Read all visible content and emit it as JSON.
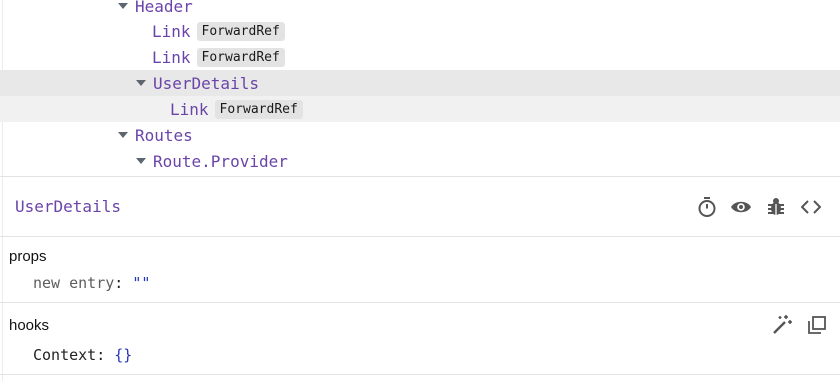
{
  "tree": {
    "rows": [
      {
        "name": "Header",
        "expanded": true,
        "badge": null
      },
      {
        "name": "Link",
        "expanded": false,
        "badge": "ForwardRef"
      },
      {
        "name": "Link",
        "expanded": false,
        "badge": "ForwardRef"
      },
      {
        "name": "UserDetails",
        "expanded": true,
        "badge": null,
        "selected": true
      },
      {
        "name": "Link",
        "expanded": false,
        "badge": "ForwardRef"
      },
      {
        "name": "Routes",
        "expanded": true,
        "badge": null
      },
      {
        "name": "Route.Provider",
        "expanded": true,
        "badge": null
      }
    ]
  },
  "inspector": {
    "title": "UserDetails",
    "toolbar": [
      "stopwatch-icon",
      "eye-icon",
      "bug-icon",
      "code-icon"
    ]
  },
  "props": {
    "title": "props",
    "entry_key": "new entry",
    "entry_value": "\"\""
  },
  "hooks": {
    "title": "hooks",
    "entry_key": "Context",
    "entry_value": "{}",
    "toolbar": [
      "magic-wand-icon",
      "copy-icon"
    ]
  },
  "colors": {
    "component": "#6a44a8",
    "value": "#2636b8",
    "selected_row": "#e8e8e8"
  }
}
